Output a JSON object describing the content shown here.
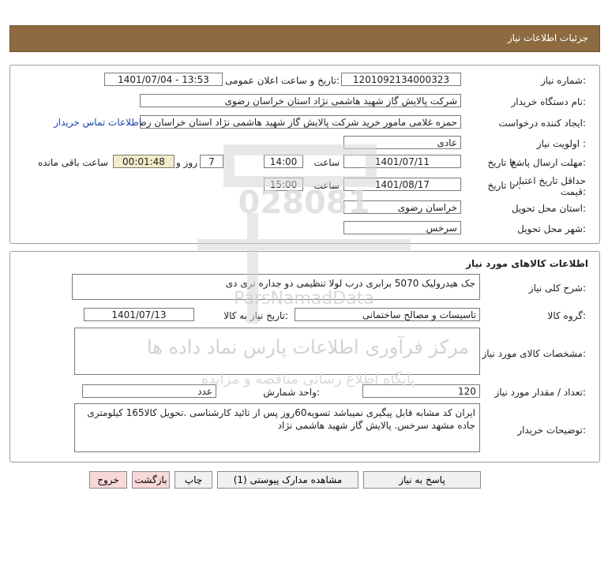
{
  "header": {
    "title": "جزئیات اطلاعات نیاز"
  },
  "need_info": {
    "need_number": {
      "label": "شماره نیاز:",
      "value": "1201092134000323"
    },
    "announce": {
      "label": "تاریخ و ساعت اعلان عمومی:",
      "value": "1401/07/04 - 13:53"
    },
    "buyer_org": {
      "label": "نام دستگاه خریدار:",
      "value": "شرکت پالایش گاز شهید هاشمی نژاد   استان خراسان رضوی"
    },
    "creator": {
      "label": "ایجاد کننده درخواست:",
      "value": "حمزه غلامی مامور خرید شرکت پالایش گاز شهید هاشمی نژاد   استان خراسان رضوی",
      "contact_link": "اطلاعات تماس خریدار"
    },
    "priority": {
      "label": "اولویت نیاز :",
      "value": "عادی"
    },
    "deadline": {
      "label": "مهلت ارسال پاسخ:",
      "to_date_label": "تا تاریخ :",
      "date": "1401/07/11",
      "time_label": "ساعت",
      "time": "14:00",
      "days": "7",
      "days_label": "روز و",
      "remaining": "00:01:48",
      "remaining_label": "ساعت باقی مانده"
    },
    "validity": {
      "label": "حداقل تاریخ اعتبار قیمت:",
      "to_date_label": "تا تاریخ :",
      "date": "1401/08/17",
      "time_label": "ساعت",
      "time": "15:00"
    },
    "delivery_province": {
      "label": "استان محل تحویل:",
      "value": "خراسان رضوی"
    },
    "delivery_city": {
      "label": "شهر محل تحویل:",
      "value": "سرخس"
    }
  },
  "goods": {
    "title": "اطلاعات کالاهای مورد نیاز",
    "summary": {
      "label": "شرح کلی نیاز:",
      "value": "جک هیدرولیک 5070 برابری درب لولا تنظیمی دو جداره تری دی"
    },
    "group": {
      "label": "گروه کالا:",
      "value": "تاسیسات و مصالح ساختمانی"
    },
    "need_date": {
      "label": "تاریخ نیاز به کالا:",
      "value": "1401/07/13"
    },
    "specs": {
      "label": "مشخصات کالای مورد نیاز:",
      "value": ""
    },
    "quantity": {
      "label": "تعداد / مقدار مورد نیاز:",
      "value": "120"
    },
    "unit": {
      "label": "واحد شمارش:",
      "value": "عدد"
    },
    "buyer_notes": {
      "label": "توضیحات خریدار:",
      "value": "ایران کد مشابه قابل پیگیری نمیباشد تسویه60روز پس از تائید کارشناسی .تحویل کالا165 کیلومتری جاده مشهد سرخس. پالایش گاز شهید هاشمی نژاد"
    }
  },
  "buttons": {
    "reply": "پاسخ به نیاز",
    "view_docs": "مشاهده مدارک پیوستی (1)",
    "print": "چاپ",
    "back": "بازگشت",
    "exit": "خروج"
  },
  "watermark": {
    "line1": "مرکز فرآوری اطلاعات پارس نماد داده ها",
    "line2": "پایگاه اطلاع رسانی مناقصه و مزایده",
    "brand": "ParsNamadData"
  },
  "colors": {
    "header_bg": "#8d6a3f",
    "link": "#1a45a8",
    "timer_bg": "#f2ecc8",
    "exit_btn_bg": "#f8d9d9"
  }
}
